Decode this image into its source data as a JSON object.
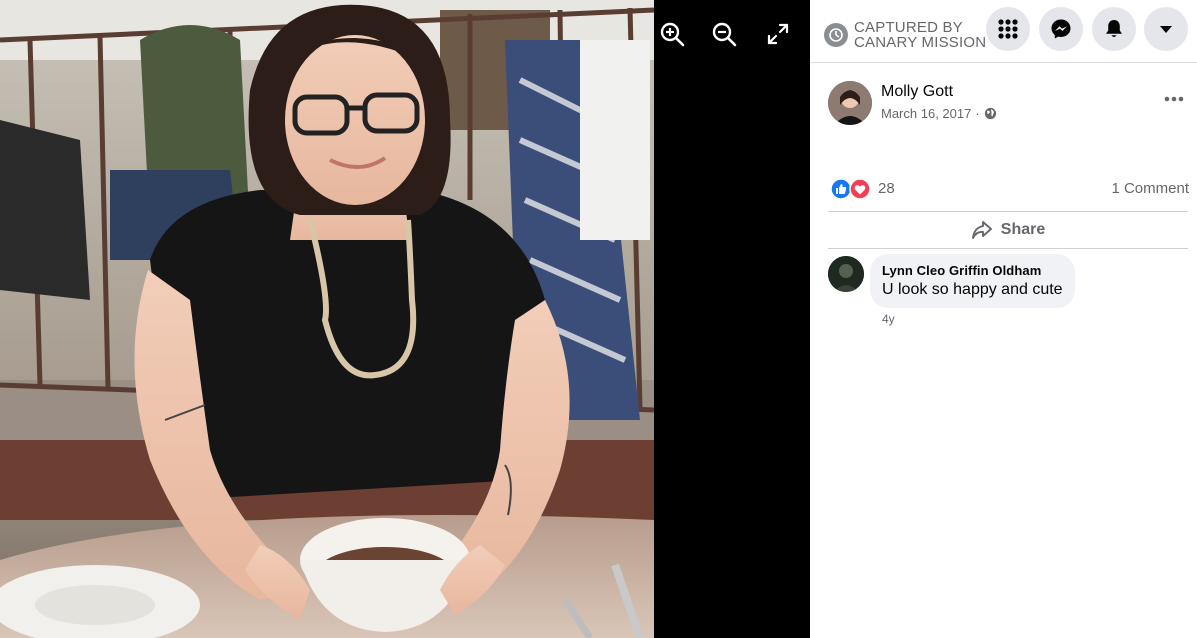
{
  "watermark": {
    "line1": "CAPTURED BY",
    "line2": "CANARY MISSION"
  },
  "viewer": {
    "photo_alt": "",
    "tools": [
      "zoom-in-icon",
      "zoom-out-icon",
      "fullscreen-icon"
    ]
  },
  "topbar": {
    "buttons": [
      "menu-grid-icon",
      "messenger-icon",
      "notifications-bell-icon",
      "account-dropdown-icon"
    ]
  },
  "post": {
    "author": "Molly Gott",
    "date": "March 16, 2017",
    "separator": "·",
    "privacy_icon": "globe-icon",
    "reaction_types": [
      "like",
      "love"
    ],
    "reaction_count": "28",
    "comment_count": "1 Comment",
    "share_label": "Share"
  },
  "comments": [
    {
      "name": "Lynn Cleo Griffin Oldham",
      "text": "U look so happy and cute",
      "time": "4y"
    }
  ],
  "colors": {
    "like_blue": "#1877f2",
    "love_red": "#f33e58",
    "panel_bg": "#ffffff",
    "viewer_bg": "#000000"
  }
}
